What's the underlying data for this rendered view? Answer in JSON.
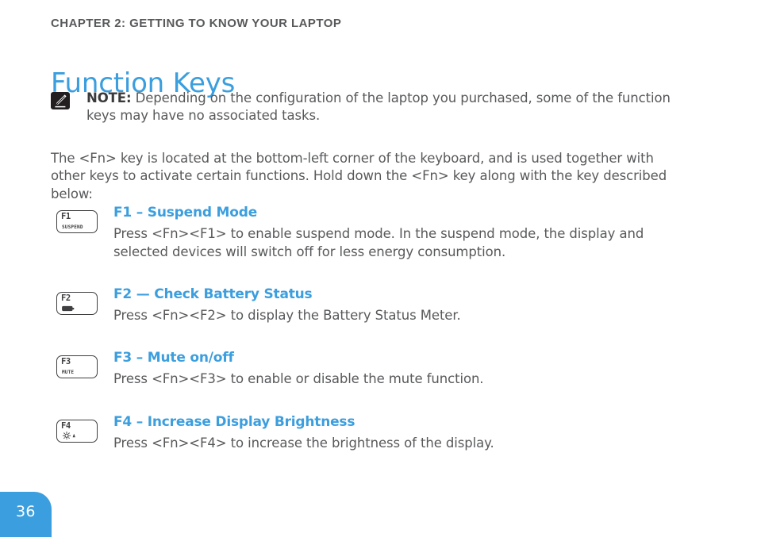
{
  "document": {
    "chapter_header": "CHAPTER 2: GETTING TO KNOW YOUR LAPTOP",
    "title": "Function Keys",
    "page_number": "36"
  },
  "note": {
    "icon": "note-pencil-icon",
    "label": "NOTE:",
    "text": "Depending on the configuration of the laptop you purchased, some of the function keys may have no associated tasks."
  },
  "intro": {
    "paragraph": "The <Fn> key is located at the bottom-left corner of the keyboard, and is used together with other keys to activate certain functions. Hold down the <Fn> key along with the key described below:"
  },
  "function_keys": [
    {
      "key_label": "F1",
      "key_sub": "SUSPEND",
      "key_glyph": "",
      "icon_name": "key-f1-suspend-icon",
      "heading": "F1 – Suspend Mode",
      "description": "Press <Fn><F1> to enable suspend mode. In the suspend mode, the display and selected devices will switch off for less energy consumption."
    },
    {
      "key_label": "F2",
      "key_sub": "",
      "key_glyph": "battery-icon",
      "icon_name": "key-f2-battery-icon",
      "heading": "F2 — Check Battery Status",
      "description": "Press <Fn><F2> to display the Battery Status Meter."
    },
    {
      "key_label": "F3",
      "key_sub": "MUTE",
      "key_glyph": "",
      "icon_name": "key-f3-mute-icon",
      "heading": "F3 – Mute on/off",
      "description": "Press <Fn><F3> to enable or disable the mute function."
    },
    {
      "key_label": "F4",
      "key_sub": "",
      "key_glyph": "brightness-up-icon",
      "icon_name": "key-f4-brightness-icon",
      "heading": "F4 – Increase Display Brightness",
      "description": "Press <Fn><F4> to increase the brightness of the display."
    }
  ],
  "colors": {
    "accent_blue": "#3b9ede",
    "body_gray": "#58595b",
    "note_icon_dark": "#231f20"
  }
}
